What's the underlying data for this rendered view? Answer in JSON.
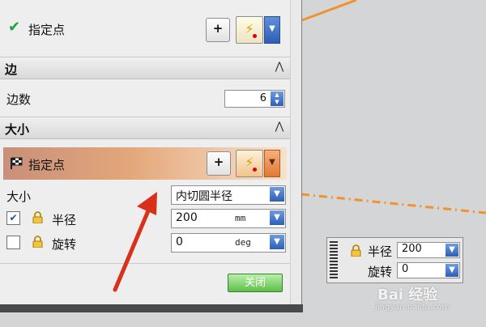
{
  "top_specify_point": {
    "label": "指定点"
  },
  "edge_section": {
    "title": "边",
    "sides_label": "边数",
    "sides_value": "6"
  },
  "size_section": {
    "title": "大小",
    "specify_point_label": "指定点",
    "size_label": "大小",
    "size_option": "内切圆半径",
    "radius": {
      "label": "半径",
      "value": "200",
      "unit": "mm",
      "checked": true
    },
    "rotation": {
      "label": "旋转",
      "value": "0",
      "unit": "deg",
      "checked": false
    }
  },
  "close_button": {
    "label": "关闭"
  },
  "floating_inputs": {
    "radius_label": "半径",
    "radius_value": "200",
    "rotation_label": "旋转",
    "rotation_value": "0"
  },
  "watermark": {
    "text": "Bai 经验",
    "sub": "jingyan.baidu.com"
  },
  "colors": {
    "accent_orange": "#f0a060",
    "canvas": "#d4d5d7",
    "arrow_red": "#d9301a",
    "close_green": "#5fbf4a"
  },
  "icons": [
    "checkmark-icon",
    "flag-icon",
    "lock-icon",
    "lightning-icon",
    "collapse-chevron-icon",
    "spinner-arrows-icon",
    "dropdown-arrow-icon"
  ]
}
